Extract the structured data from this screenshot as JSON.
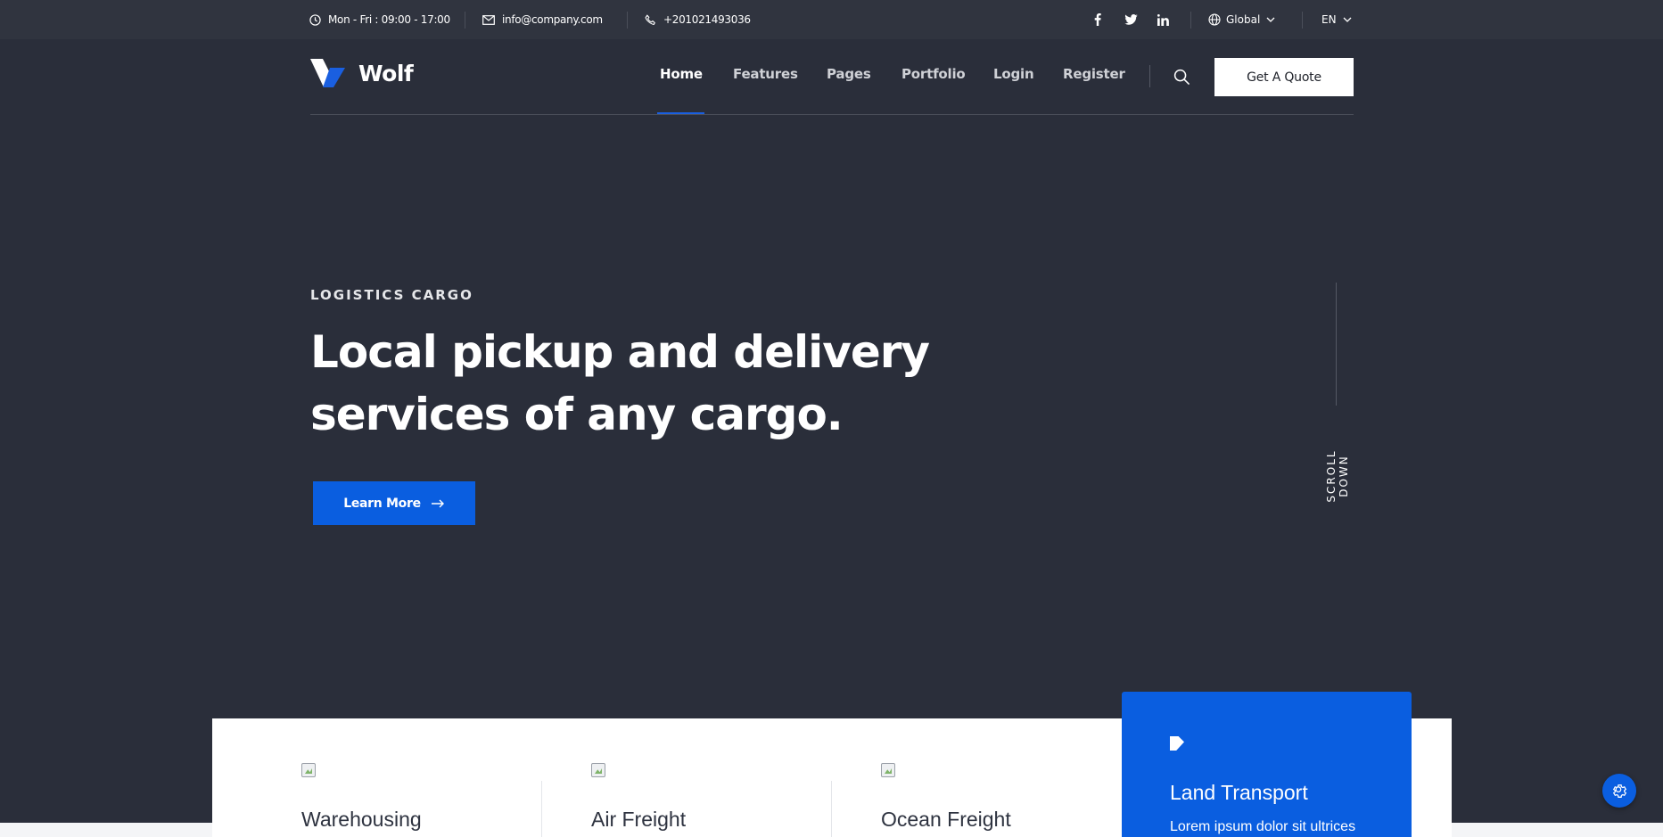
{
  "topbar": {
    "hours": "Mon - Fri : 09:00 - 17:00",
    "email": "info@company.com",
    "phone": "+201021493036",
    "social_icons": [
      "facebook-icon",
      "twitter-icon",
      "linkedin-icon"
    ],
    "region": "Global",
    "language": "EN"
  },
  "header": {
    "brand": "Wolf",
    "nav": [
      "Home",
      "Features",
      "Pages",
      "Portfolio",
      "Login",
      "Register"
    ],
    "active_nav": "Home",
    "quote_button": "Get A Quote"
  },
  "hero": {
    "eyebrow": "LOGISTICS CARGO",
    "title_line1": "Local pickup and delivery",
    "title_line2": "services of any cargo.",
    "cta": "Learn More",
    "scroll_label": "SCROLL DOWN"
  },
  "services": [
    {
      "name": "Warehousing"
    },
    {
      "name": "Air Freight"
    },
    {
      "name": "Ocean Freight"
    },
    {
      "name": "Land Transport",
      "description": "Lorem ipsum dolor sit ultrices"
    }
  ],
  "colors": {
    "background": "#2a2e3a",
    "topbar": "#30343f",
    "accent": "#0a5ee0",
    "white": "#ffffff"
  }
}
